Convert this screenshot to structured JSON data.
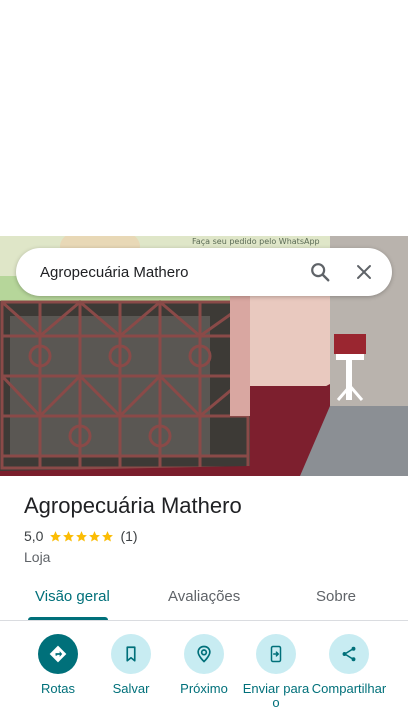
{
  "search": {
    "query": "Agropecuária Mathero"
  },
  "place": {
    "title": "Agropecuária Mathero",
    "rating": "5,0",
    "stars": 5,
    "review_count": "(1)",
    "category": "Loja"
  },
  "photo": {
    "banner_text": "Faça seu pedido pelo WhatsApp"
  },
  "tabs": [
    {
      "label": "Visão geral",
      "active": true
    },
    {
      "label": "Avaliações",
      "active": false
    },
    {
      "label": "Sobre",
      "active": false
    }
  ],
  "actions": [
    {
      "label": "Rotas",
      "icon": "directions-icon"
    },
    {
      "label": "Salvar",
      "icon": "bookmark-icon"
    },
    {
      "label": "Próximo",
      "icon": "nearby-icon"
    },
    {
      "label": "Enviar para o",
      "icon": "send-to-phone-icon"
    },
    {
      "label": "Compartilhar",
      "icon": "share-icon"
    }
  ],
  "colors": {
    "accent": "#00707a",
    "action_bg": "#c8ecf2",
    "star": "#fbbc04"
  }
}
